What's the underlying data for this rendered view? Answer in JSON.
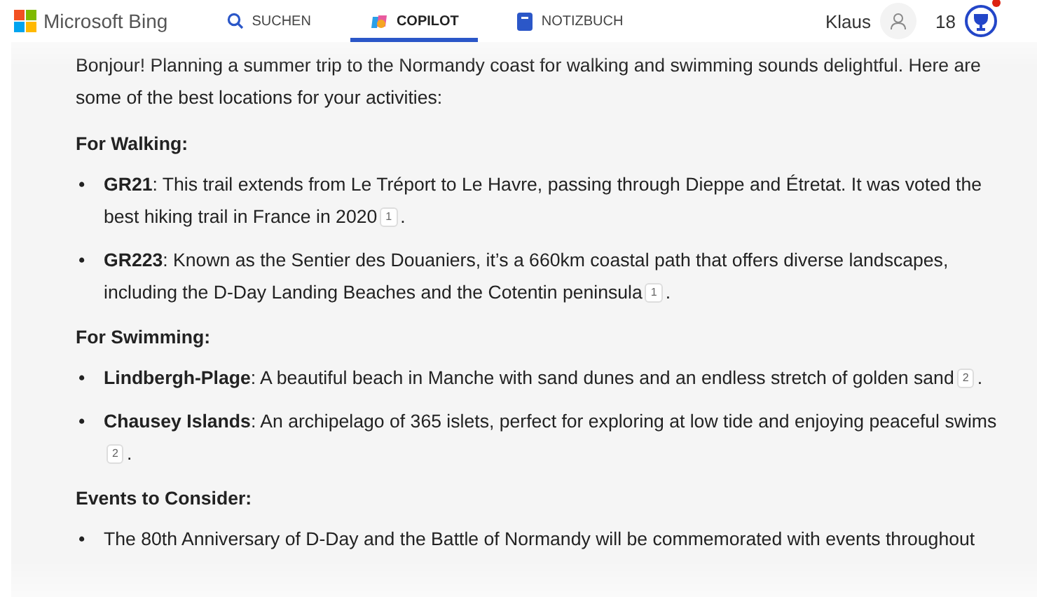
{
  "header": {
    "logo": "Microsoft Bing",
    "tabs": [
      {
        "label": "SUCHEN",
        "kind": "search",
        "selected": false
      },
      {
        "label": "COPILOT",
        "kind": "copilot",
        "selected": true
      },
      {
        "label": "NOTIZBUCH",
        "kind": "notebook",
        "selected": false
      }
    ],
    "user": "Klaus",
    "points": "18",
    "notification": true
  },
  "content": {
    "intro": "Bonjour! Planning a summer trip to the Normandy coast for walking and swimming sounds delightful. Here are some of the best locations for your activities:",
    "sections": [
      {
        "heading": "For Walking:",
        "items": [
          {
            "marker": "•",
            "text": "**GR21**: This trail extends from Le Tréport to Le Havre, passing through Dieppe and Étretat. It was voted the best hiking trail in France in 2020",
            "citation": "1",
            "suffix": "."
          },
          {
            "marker": "•",
            "text": "**GR223**: Known as the Sentier des Douaniers, it’s a 660km coastal path that offers diverse landscapes, including the D-Day Landing Beaches and the Cotentin peninsula",
            "citation": "1",
            "suffix": "."
          }
        ]
      },
      {
        "heading": "For Swimming:",
        "items": [
          {
            "marker": "•",
            "text": "**Lindbergh-Plage**: A beautiful beach in Manche with sand dunes and an endless stretch of golden sand",
            "citation": "2",
            "suffix": "."
          },
          {
            "marker": "•",
            "text": "**Chausey Islands**: An archipelago of 365 islets, perfect for exploring at low tide and enjoying peaceful swims",
            "citation": "2",
            "suffix": "."
          }
        ]
      },
      {
        "heading": "Events to Consider:",
        "items": [
          {
            "marker": "•",
            "text": "The 80th Anniversary of D-Day and the Battle of Normandy will be commemorated with events throughout"
          }
        ]
      }
    ]
  }
}
